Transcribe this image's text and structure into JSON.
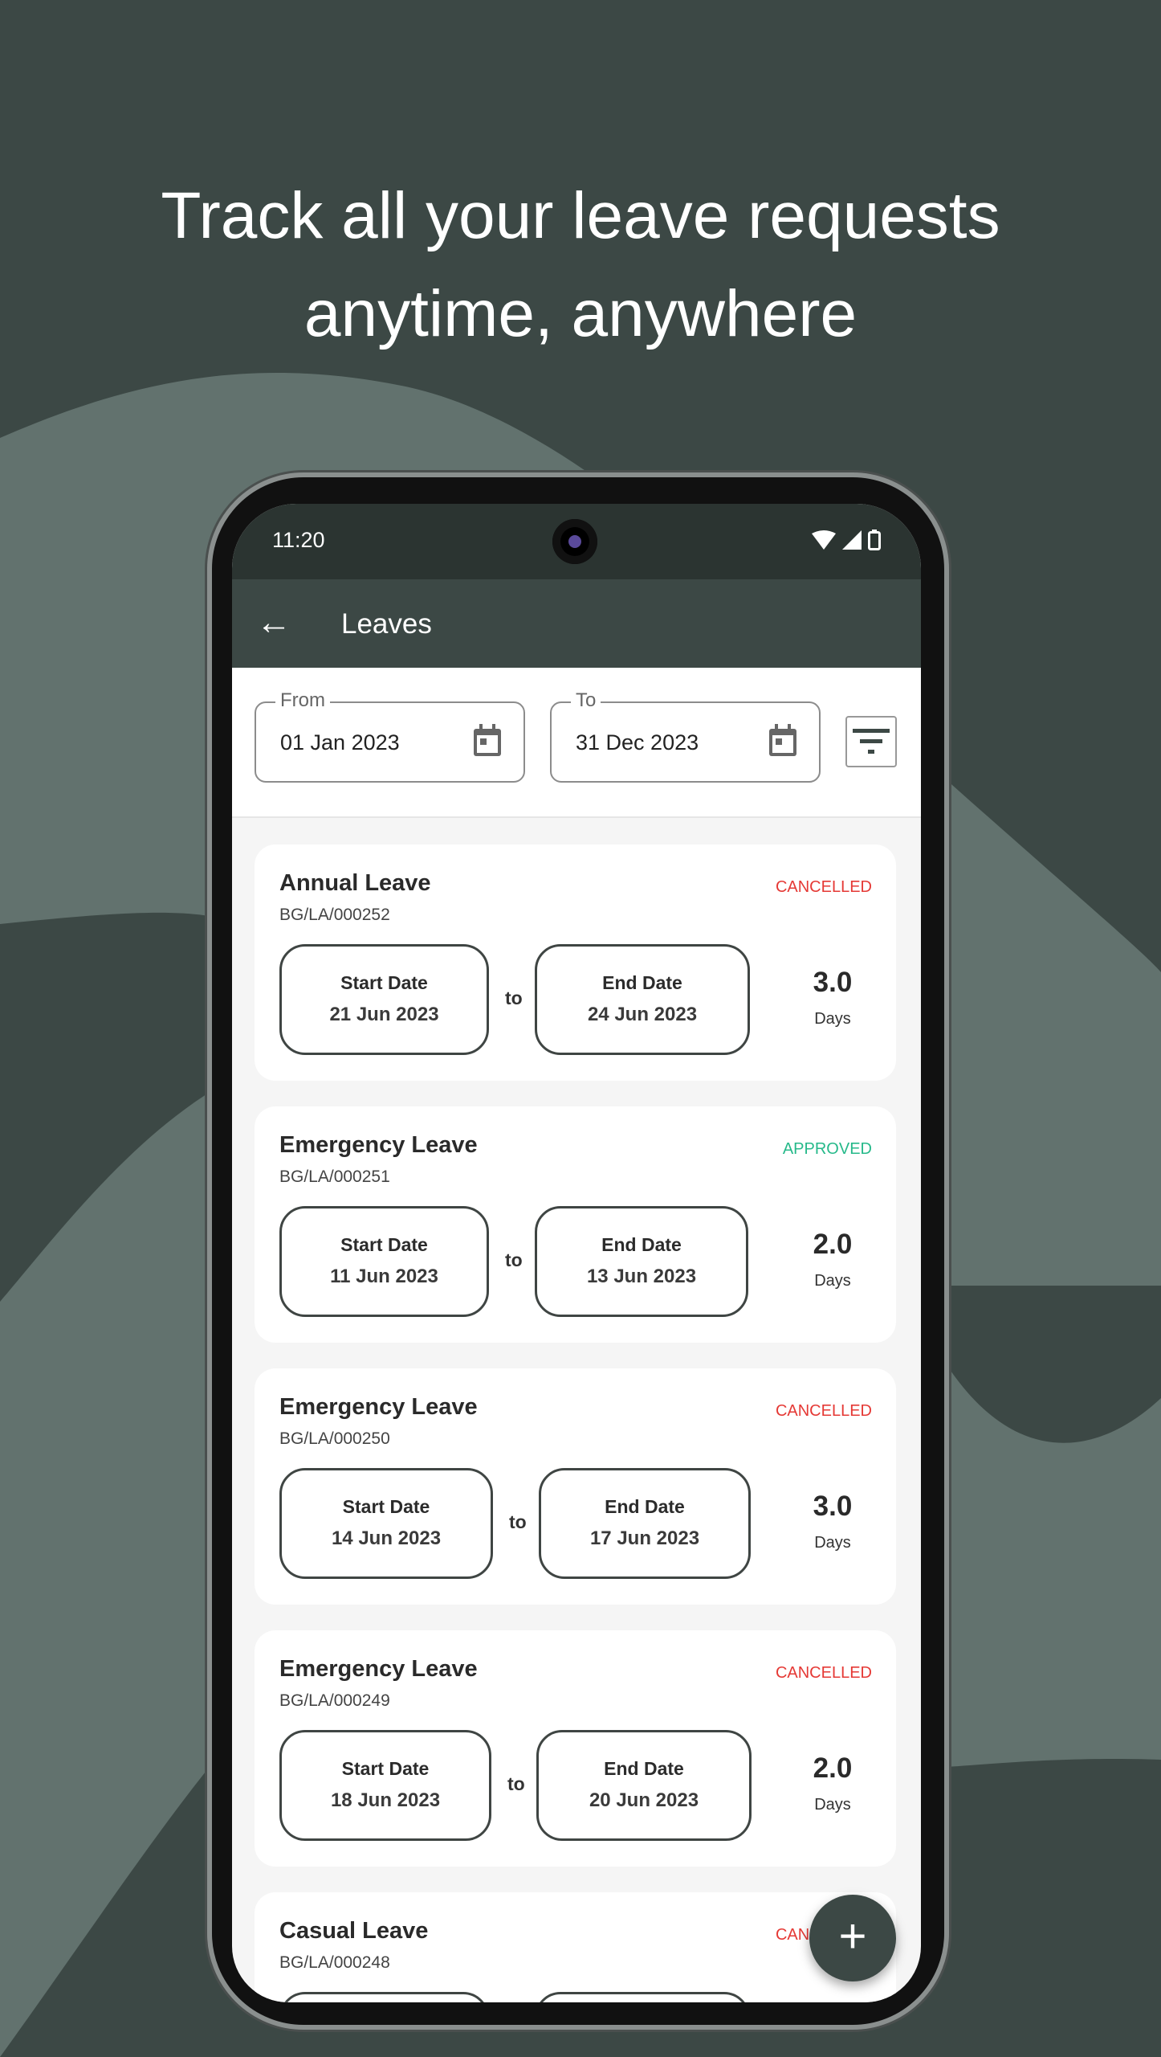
{
  "headline": [
    "Track all your leave requests",
    "anytime, anywhere"
  ],
  "colors": {
    "background": "#3c4845",
    "wave": "#62726e",
    "primary": "#3c4845",
    "cancelled": "#e53935",
    "approved": "#26b98a"
  },
  "status_bar": {
    "time": "11:20",
    "icons": [
      "wifi-icon",
      "signal-icon",
      "battery-icon"
    ]
  },
  "app_bar": {
    "title": "Leaves",
    "back_icon": "arrow-left-icon"
  },
  "filters": {
    "from": {
      "label": "From",
      "value": "01 Jan 2023"
    },
    "to": {
      "label": "To",
      "value": "31 Dec 2023"
    },
    "filter_icon": "filter-icon"
  },
  "labels": {
    "start": "Start Date",
    "end": "End Date",
    "to": "to",
    "days": "Days"
  },
  "leaves": [
    {
      "type": "Annual Leave",
      "id": "BG/LA/000252",
      "status": "CANCELLED",
      "start": "21 Jun 2023",
      "end": "24 Jun 2023",
      "days": "3.0"
    },
    {
      "type": "Emergency Leave",
      "id": "BG/LA/000251",
      "status": "APPROVED",
      "start": "11 Jun 2023",
      "end": "13 Jun 2023",
      "days": "2.0"
    },
    {
      "type": "Emergency Leave",
      "id": "BG/LA/000250",
      "status": "CANCELLED",
      "start": "14 Jun 2023",
      "end": "17 Jun 2023",
      "days": "3.0"
    },
    {
      "type": "Emergency Leave",
      "id": "BG/LA/000249",
      "status": "CANCELLED",
      "start": "18 Jun 2023",
      "end": "20 Jun 2023",
      "days": "2.0"
    },
    {
      "type": "Casual Leave",
      "id": "BG/LA/000248",
      "status": "CANCELLED",
      "start": "",
      "end": "",
      "days": ""
    }
  ],
  "fab": {
    "label": "+",
    "icon": "plus-icon"
  }
}
